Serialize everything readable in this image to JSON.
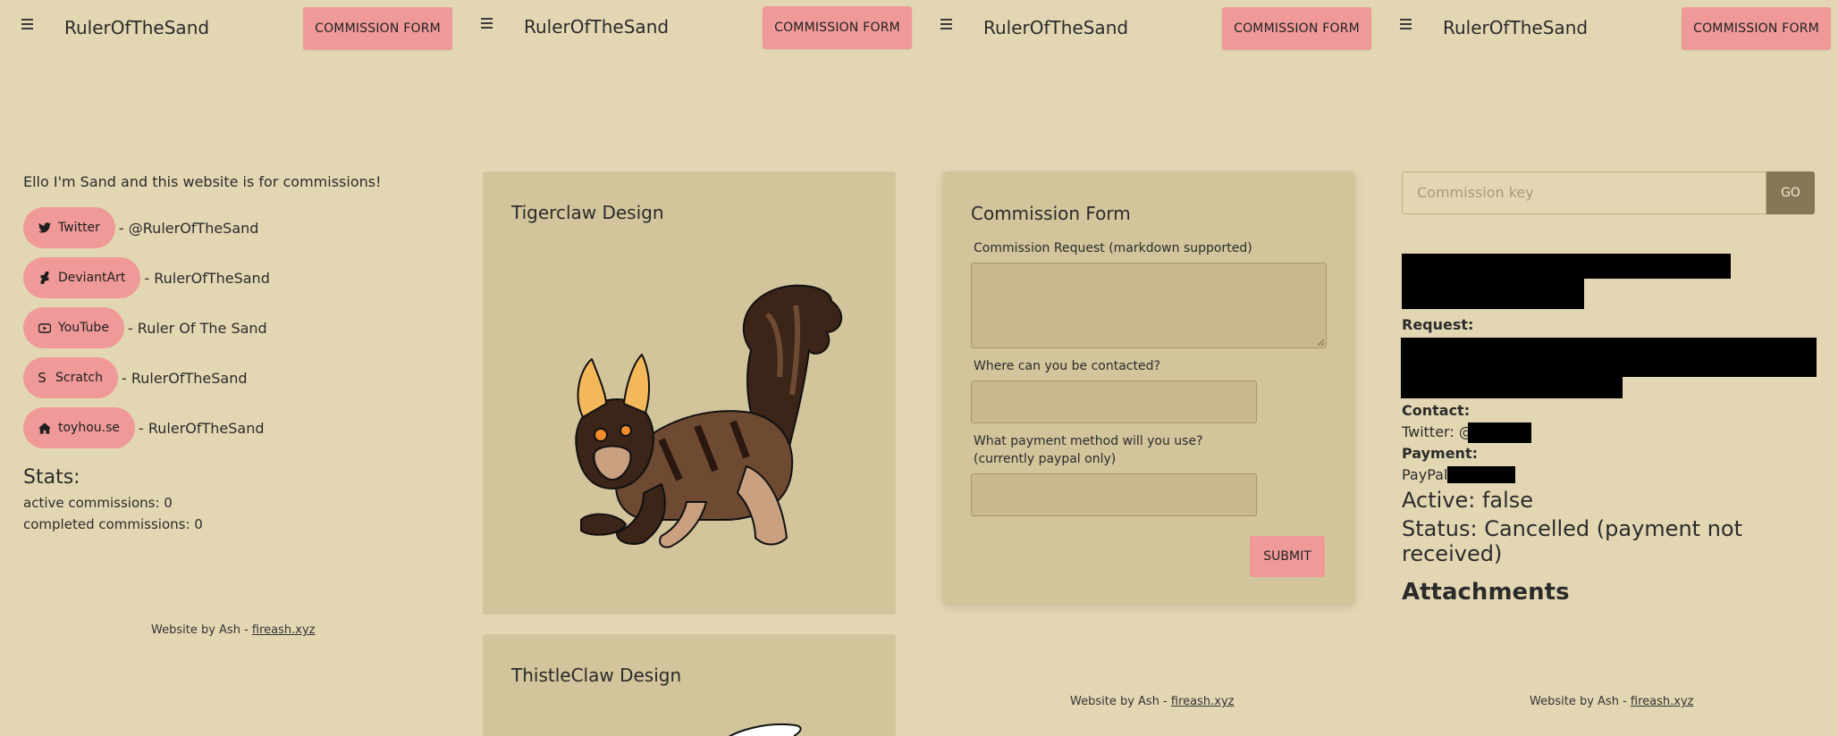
{
  "brand": "RulerOfTheSand",
  "commission_button": "COMMISSION FORM",
  "home": {
    "intro": "Ello I'm Sand and this website is for commissions!",
    "socials": [
      {
        "label": "Twitter",
        "icon": "twitter-icon",
        "handle": "- @RulerOfTheSand"
      },
      {
        "label": "DeviantArt",
        "icon": "deviantart-icon",
        "handle": "- RulerOfTheSand"
      },
      {
        "label": "YouTube",
        "icon": "youtube-icon",
        "handle": "- Ruler Of The Sand"
      },
      {
        "label": "Scratch",
        "icon": "scratch-icon",
        "handle": "- RulerOfTheSand"
      },
      {
        "label": "toyhou.se",
        "icon": "home-icon",
        "handle": "- RulerOfTheSand"
      }
    ],
    "stats_title": "Stats:",
    "active_commissions": "active commissions: 0",
    "completed_commissions": "completed commissions: 0"
  },
  "footer": {
    "prefix": "Website by Ash - ",
    "link": "fireash.xyz"
  },
  "gallery": {
    "cards": [
      {
        "title": "Tigerclaw Design"
      },
      {
        "title": "ThistleClaw Design"
      }
    ]
  },
  "form": {
    "title": "Commission Form",
    "request_label": "Commission Request (markdown supported)",
    "contact_label": "Where can you be contacted?",
    "payment_label": "What payment method will you use? (currently paypal only)",
    "submit": "SUBMIT"
  },
  "lookup": {
    "placeholder": "Commission key",
    "go": "GO",
    "request_label": "Request:",
    "contact_label": "Contact:",
    "contact_value": "Twitter: @",
    "payment_label": "Payment:",
    "payment_value": "PayPal",
    "active": "Active: false",
    "status": "Status: Cancelled (payment not received)",
    "attachments": "Attachments"
  },
  "colors": {
    "background": "#e3d7b3",
    "card": "#d2c59c",
    "accent": "#ef9a98",
    "go_button": "#857656"
  }
}
